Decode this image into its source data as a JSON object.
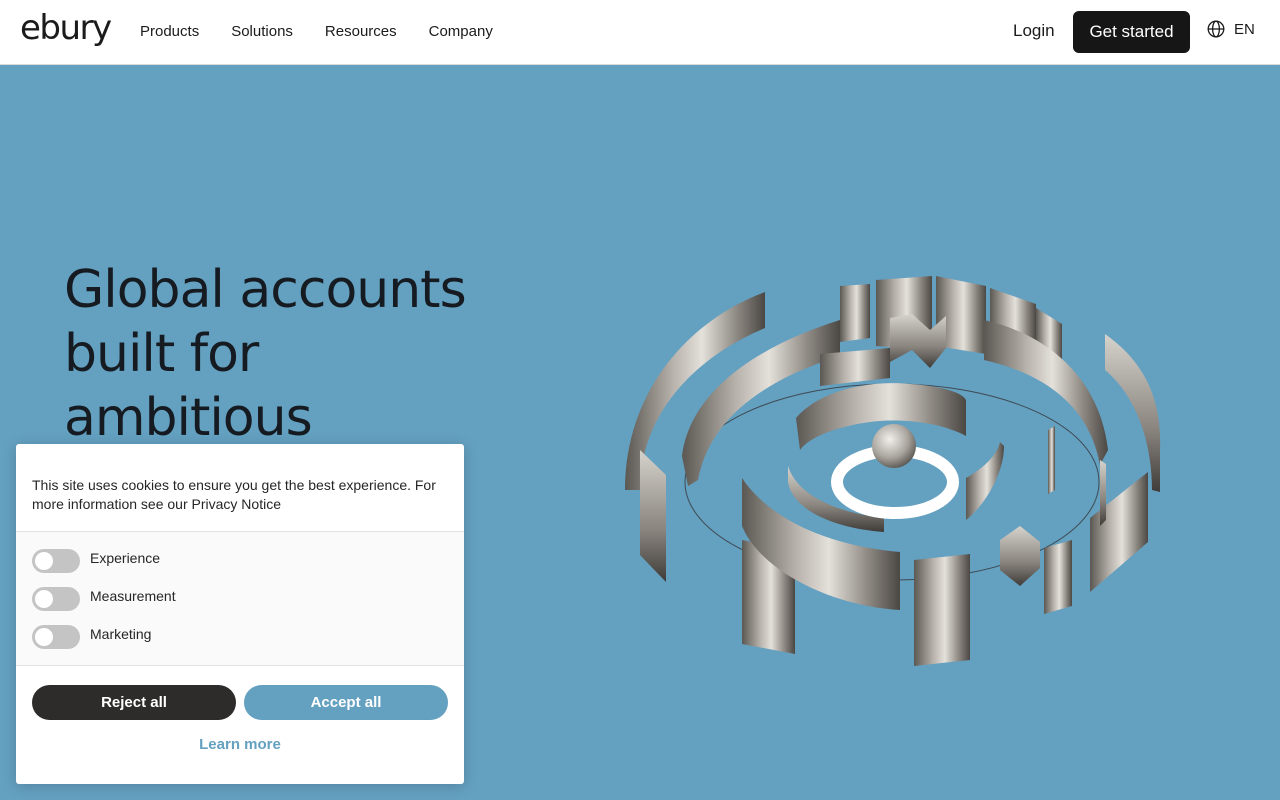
{
  "header": {
    "logo": "ebury",
    "nav": [
      "Products",
      "Solutions",
      "Resources",
      "Company"
    ],
    "login_label": "Login",
    "cta_label": "Get started",
    "language": "EN",
    "language_icon": "globe-icon"
  },
  "hero": {
    "title_lines": [
      "Global accounts",
      "built for",
      "ambitious"
    ]
  },
  "cookie_banner": {
    "message": "This site uses cookies to ensure you get the best experience. For more information see our Privacy Notice",
    "options": [
      {
        "label": "Experience",
        "enabled": false
      },
      {
        "label": "Measurement",
        "enabled": false
      },
      {
        "label": "Marketing",
        "enabled": false
      }
    ],
    "reject_label": "Reject all",
    "accept_label": "Accept all",
    "learn_more_label": "Learn more"
  },
  "colors": {
    "hero_background": "#64a0c0",
    "primary_dark": "#161616",
    "accent": "#64a0c0",
    "toggle_off": "#c4c4c4"
  }
}
